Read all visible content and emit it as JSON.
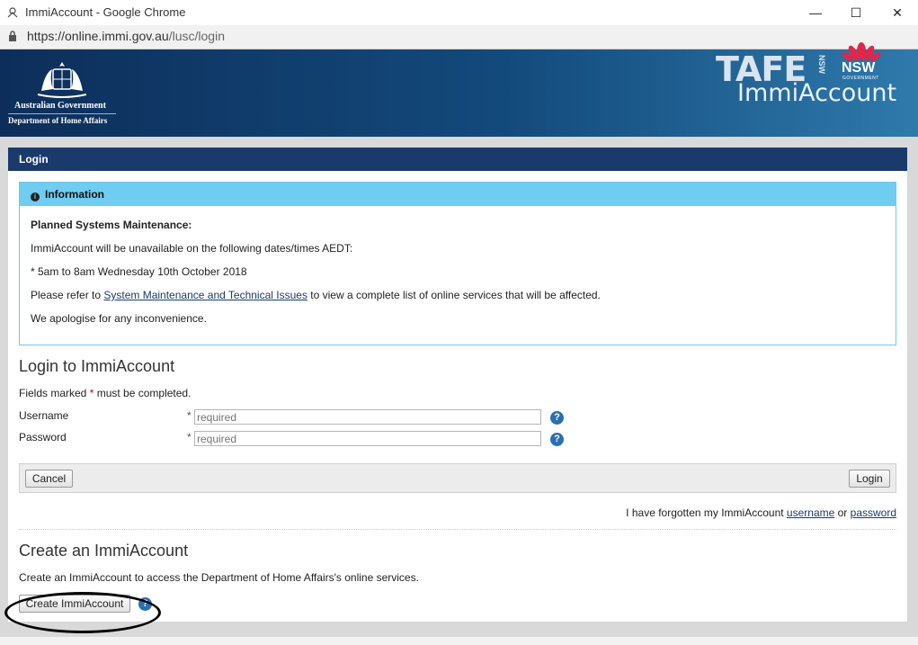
{
  "browser": {
    "window_title": "ImmiAccount - Google Chrome",
    "url_host": "https://online.immi.gov.au",
    "url_path": "/lusc/login",
    "minimize": "—",
    "maximize": "☐",
    "close": "✕"
  },
  "banner": {
    "gov_line1": "Australian Government",
    "gov_line2": "Department of Home Affairs",
    "tafe": "TAFE",
    "tafe_nsw": "NSW",
    "nsw": "NSW",
    "nsw_government": "GOVERNMENT",
    "product": "ImmiAccount"
  },
  "login_section": {
    "header": "Login"
  },
  "info": {
    "header": "Information",
    "heading": "Planned Systems Maintenance:",
    "line1": "ImmiAccount will be unavailable on the following dates/times AEDT:",
    "line2": "* 5am to 8am Wednesday 10th October 2018",
    "line3_pre": "Please refer to ",
    "line3_link": "System Maintenance and Technical Issues",
    "line3_post": " to view a complete list of online services that will be affected.",
    "line4": "We apologise for any inconvenience."
  },
  "form": {
    "title": "Login to ImmiAccount",
    "fields_note_pre": "Fields marked ",
    "asterisk": "*",
    "fields_note_post": " must be completed.",
    "username_label": "Username",
    "username_placeholder": "required",
    "password_label": "Password",
    "password_placeholder": "required",
    "help": "?",
    "cancel": "Cancel",
    "login": "Login",
    "forgot_pre": "I have forgotten my ImmiAccount ",
    "forgot_username": "username",
    "forgot_or": " or ",
    "forgot_password": "password"
  },
  "create": {
    "title": "Create an ImmiAccount",
    "description": "Create an ImmiAccount to access the Department of Home Affairs's online services.",
    "button": "Create ImmiAccount"
  },
  "colors": {
    "header_navy": "#1a3a6b",
    "info_blue": "#6fcdf1",
    "help_blue": "#2b6fb0"
  }
}
